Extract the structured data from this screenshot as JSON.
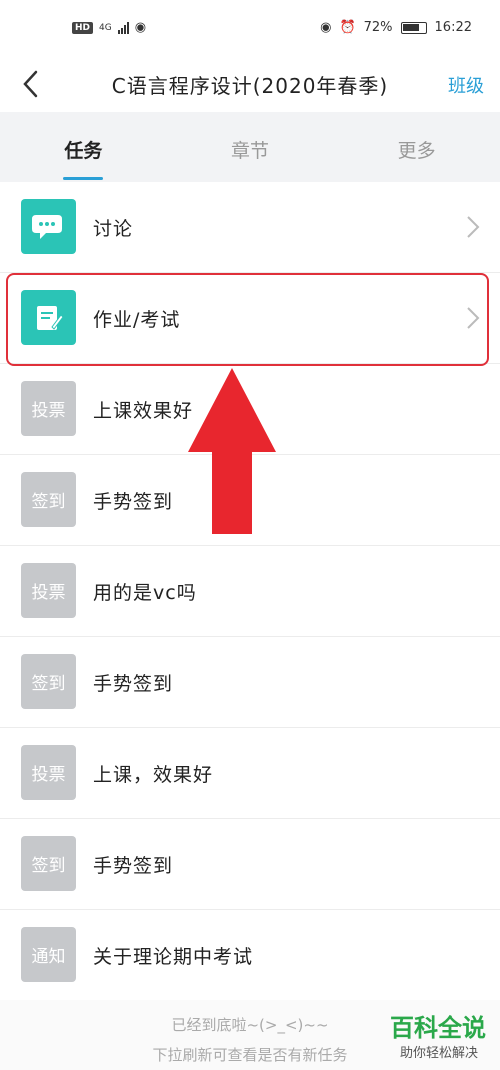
{
  "status_bar": {
    "left_badge": "HD",
    "network": "4G",
    "battery": "72%",
    "time": "16:22"
  },
  "header": {
    "title": "C语言程序设计(2020年春季)",
    "right_link": "班级"
  },
  "tabs": [
    {
      "label": "任务",
      "active": true
    },
    {
      "label": "章节",
      "active": false
    },
    {
      "label": "更多",
      "active": false
    }
  ],
  "list": [
    {
      "icon": "chat-icon",
      "badge": "",
      "label": "讨论"
    },
    {
      "icon": "edit-icon",
      "badge": "",
      "label": "作业/考试"
    },
    {
      "icon": "",
      "badge": "投票",
      "label": "上课效果好"
    },
    {
      "icon": "",
      "badge": "签到",
      "label": "手势签到"
    },
    {
      "icon": "",
      "badge": "投票",
      "label": "用的是vc吗"
    },
    {
      "icon": "",
      "badge": "签到",
      "label": "手势签到"
    },
    {
      "icon": "",
      "badge": "投票",
      "label": "上课，效果好"
    },
    {
      "icon": "",
      "badge": "签到",
      "label": "手势签到"
    },
    {
      "icon": "",
      "badge": "通知",
      "label": "关于理论期中考试"
    }
  ],
  "footer": {
    "end_text": "已经到底啦~(>_<)~~",
    "hint_text": "下拉刷新可查看是否有新任务"
  },
  "watermark": {
    "main": "百科全说",
    "sub": "助你轻松解决"
  },
  "colors": {
    "accent": "#2a9fd6",
    "teal_icon": "#2bc4b6",
    "badge_grey": "#c6c8cb",
    "highlight": "#e0303a"
  }
}
